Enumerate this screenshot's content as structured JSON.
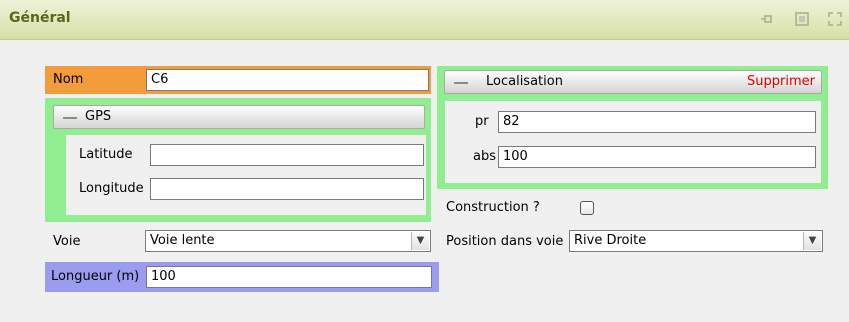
{
  "window": {
    "title": "Général",
    "toolbar_icons": [
      "pin-icon",
      "window-icon",
      "expand-icon"
    ]
  },
  "form": {
    "nom": {
      "label": "Nom",
      "value": "C6"
    },
    "gps": {
      "title": "GPS",
      "latitude": {
        "label": "Latitude",
        "value": ""
      },
      "longitude": {
        "label": "Longitude",
        "value": ""
      }
    },
    "localisation": {
      "title": "Localisation",
      "delete_label": "Supprimer",
      "pr": {
        "label": "pr",
        "value": "82"
      },
      "abs": {
        "label": "abs",
        "value": "100"
      }
    },
    "construction": {
      "label": "Construction ?",
      "checked": false
    },
    "voie": {
      "label": "Voie",
      "value": "Voie lente"
    },
    "position_voie": {
      "label": "Position dans voie",
      "value": "Rive Droite"
    },
    "longueur": {
      "label": "Longueur (m)",
      "value": "100"
    }
  },
  "colors": {
    "nom_highlight": "#f39c3c",
    "group_highlight": "#90ee90",
    "longueur_highlight": "#9b9bf0",
    "title_text": "#59661e",
    "delete_text": "#e00000"
  }
}
